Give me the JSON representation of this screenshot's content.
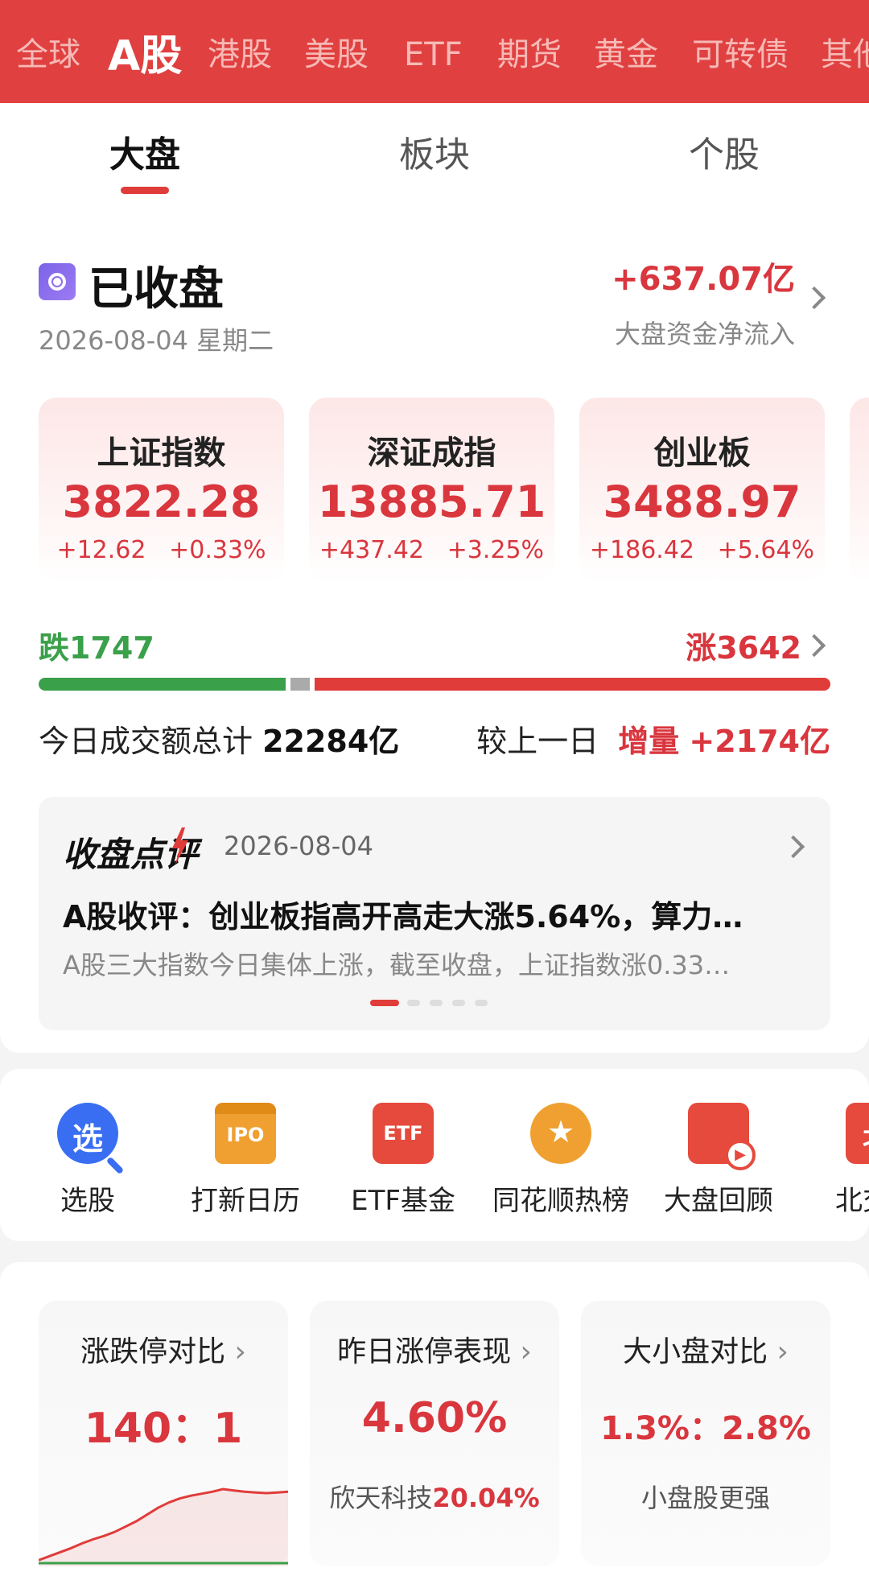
{
  "market_tabs": [
    {
      "label": "全球"
    },
    {
      "label": "A股"
    },
    {
      "label": "港股"
    },
    {
      "label": "美股"
    },
    {
      "label": "ETF"
    },
    {
      "label": "期货"
    },
    {
      "label": "黄金"
    },
    {
      "label": "可转债"
    },
    {
      "label": "其他"
    }
  ],
  "sub_tabs": [
    {
      "label": "大盘"
    },
    {
      "label": "板块"
    },
    {
      "label": "个股"
    }
  ],
  "status": {
    "title": "已收盘",
    "date": "2026-08-04 星期二",
    "net_flow_value": "+637.07亿",
    "net_flow_label": "大盘资金净流入"
  },
  "indices": [
    {
      "name": "上证指数",
      "value": "3822.28",
      "change": "+12.62",
      "pct": "+0.33%"
    },
    {
      "name": "深证成指",
      "value": "13885.71",
      "change": "+437.42",
      "pct": "+3.25%"
    },
    {
      "name": "创业板",
      "value": "3488.97",
      "change": "+186.42",
      "pct": "+5.64%"
    }
  ],
  "breadth": {
    "fall_label": "跌1747",
    "rise_label": "涨3642",
    "fall": 1747,
    "rise": 3642
  },
  "turnover": {
    "label": "今日成交额总计",
    "value": "22284亿",
    "compare_label": "较上一日",
    "compare_tag": "增量",
    "compare_value": "+2174亿"
  },
  "review": {
    "brand": "收盘点评",
    "date": "2026-08-04",
    "title": "A股收评：创业板指高开高走大涨5.64%，算力…",
    "summary": "A股三大指数今日集体上涨，截至收盘，上证指数涨0.33…"
  },
  "shortcuts": [
    {
      "label": "选股",
      "icon": "search-stock-icon",
      "glyph": "选",
      "color": "#3a6ef2"
    },
    {
      "label": "打新日历",
      "icon": "ipo-calendar-icon",
      "glyph": "IPO",
      "color": "#f0a030"
    },
    {
      "label": "ETF基金",
      "icon": "etf-icon",
      "glyph": "ETF",
      "color": "#e54a3d"
    },
    {
      "label": "同花顺热榜",
      "icon": "medal-icon",
      "glyph": "★",
      "color": "#f0a030"
    },
    {
      "label": "大盘回顾",
      "icon": "replay-icon",
      "glyph": "▶",
      "color": "#e54a3d"
    },
    {
      "label": "北交所",
      "icon": "bse-icon",
      "glyph": "北",
      "color": "#e54a3d"
    }
  ],
  "stats": [
    {
      "title": "涨跌停对比",
      "value": "140：1",
      "sub": ""
    },
    {
      "title": "昨日涨停表现",
      "value": "4.60%",
      "sub": "欣天科技",
      "sub_value": "20.04%"
    },
    {
      "title": "大小盘对比",
      "value": "1.3%：2.8%",
      "sub": "小盘股更强"
    }
  ],
  "limit_chart": {
    "up_line": [
      2,
      8,
      14,
      20,
      27,
      33,
      38,
      44,
      52,
      60,
      70,
      80,
      88,
      94,
      98,
      101,
      104,
      108,
      106,
      104,
      103,
      102,
      103,
      104
    ],
    "down_line": [
      1,
      1,
      1,
      1,
      1,
      1,
      1,
      1,
      1,
      1,
      1,
      1,
      1,
      1,
      1,
      1,
      1,
      1,
      1,
      1,
      1,
      1,
      1,
      1
    ]
  }
}
